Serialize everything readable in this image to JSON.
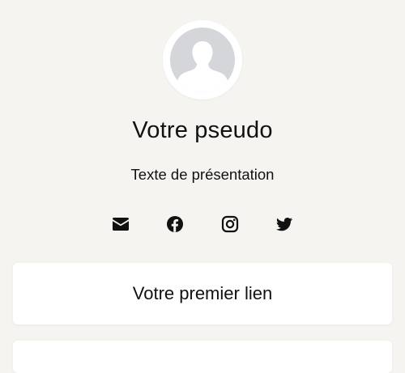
{
  "profile": {
    "username": "Votre pseudo",
    "bio": "Texte de présentation",
    "avatar_icon": "user-silhouette-icon"
  },
  "socials": [
    {
      "name": "email",
      "icon": "envelope-icon"
    },
    {
      "name": "facebook",
      "icon": "facebook-icon"
    },
    {
      "name": "instagram",
      "icon": "instagram-icon"
    },
    {
      "name": "twitter",
      "icon": "twitter-icon"
    }
  ],
  "links": [
    {
      "label": "Votre premier lien"
    },
    {
      "label": ""
    }
  ],
  "colors": {
    "background": "#f5f4f1",
    "card": "#ffffff",
    "text": "#111111",
    "avatar": "#d4d6da"
  }
}
